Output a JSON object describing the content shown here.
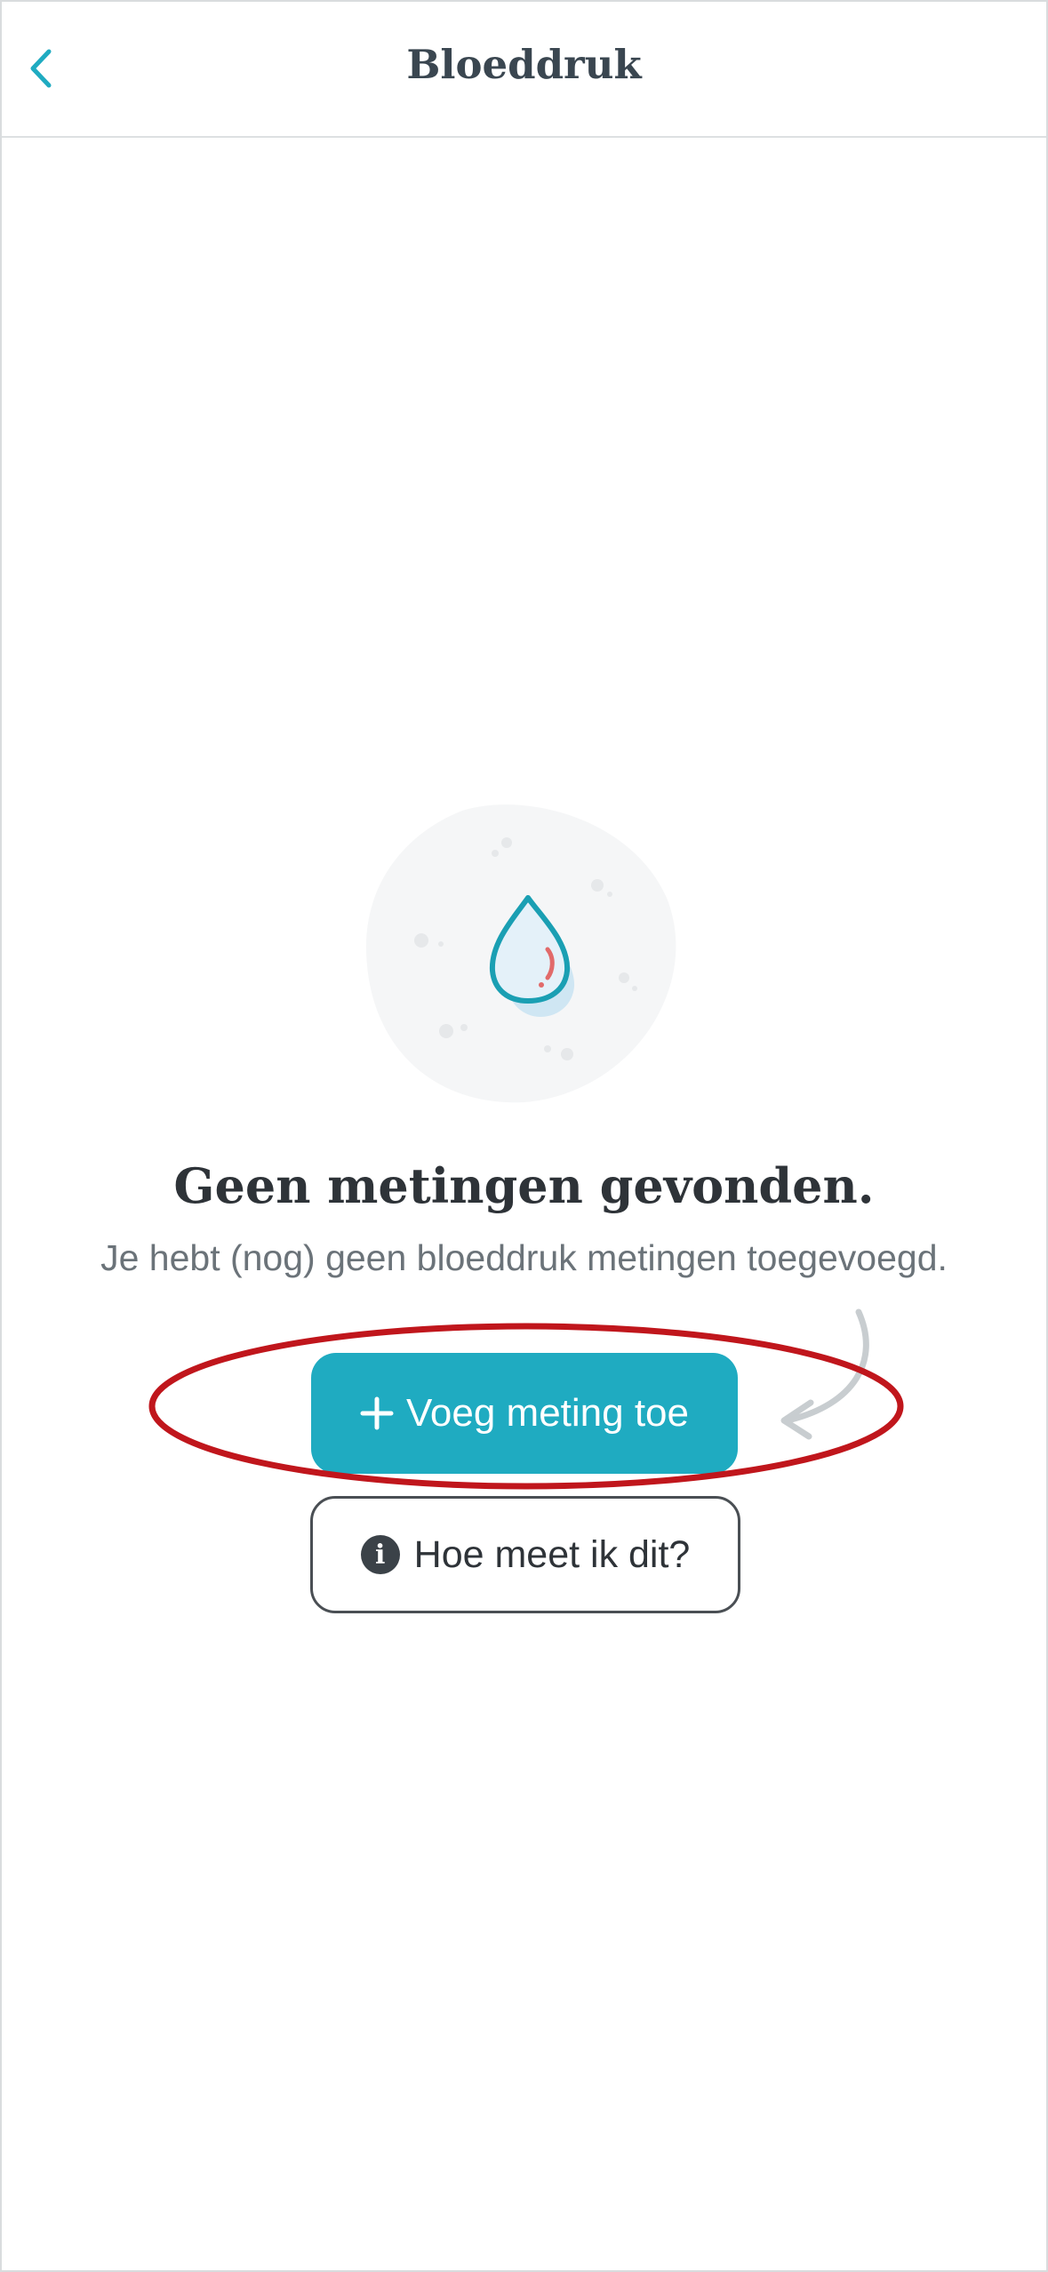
{
  "header": {
    "title": "Bloeddruk",
    "back_icon": "chevron-left-icon"
  },
  "empty_state": {
    "illustration_icon": "blood-drop-icon",
    "title": "Geen metingen gevonden.",
    "subtitle": "Je hebt (nog) geen bloeddruk metingen toegevoegd."
  },
  "actions": {
    "add_label": "Voeg meting toe",
    "add_icon": "plus-icon",
    "help_label": "Hoe meet ik dit?",
    "help_icon": "info-icon"
  },
  "colors": {
    "accent": "#1fabc1",
    "highlight_annotation": "#c0161c",
    "title_text": "#2e3338"
  }
}
